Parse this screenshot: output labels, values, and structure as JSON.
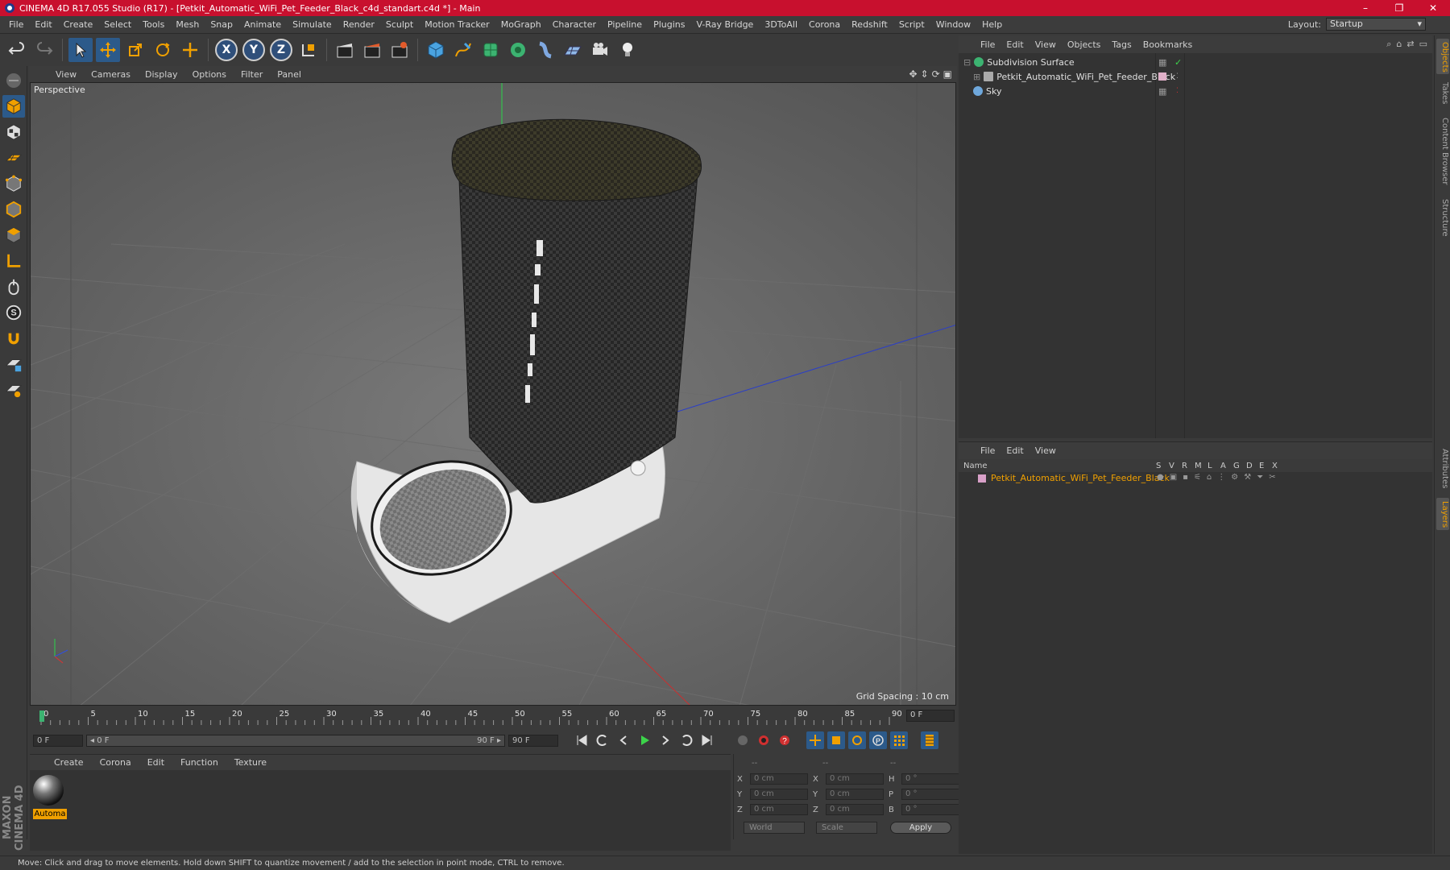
{
  "window": {
    "title": "CINEMA 4D R17.055 Studio (R17) - [Petkit_Automatic_WiFi_Pet_Feeder_Black_c4d_standart.c4d *] - Main",
    "controls": [
      "–",
      "❐",
      "✕"
    ]
  },
  "menubar": {
    "items": [
      "File",
      "Edit",
      "Create",
      "Select",
      "Tools",
      "Mesh",
      "Snap",
      "Animate",
      "Simulate",
      "Render",
      "Sculpt",
      "Motion Tracker",
      "MoGraph",
      "Character",
      "Pipeline",
      "Plugins",
      "V-Ray Bridge",
      "3DToAll",
      "Corona",
      "Redshift",
      "Script",
      "Window",
      "Help"
    ],
    "layout_label": "Layout:",
    "layout_value": "Startup"
  },
  "toolbar": {
    "axis_x": "X",
    "axis_y": "Y",
    "axis_z": "Z"
  },
  "viewport": {
    "menu": [
      "View",
      "Cameras",
      "Display",
      "Options",
      "Filter",
      "Panel"
    ],
    "label": "Perspective",
    "grid_spacing": "Grid Spacing : 10 cm",
    "nav_icons": [
      "✥",
      "⇕",
      "⟳",
      "▣"
    ]
  },
  "timeline": {
    "ticks": [
      "0",
      "5",
      "10",
      "15",
      "20",
      "25",
      "30",
      "35",
      "40",
      "45",
      "50",
      "55",
      "60",
      "65",
      "70",
      "75",
      "80",
      "85",
      "90"
    ],
    "end_field": "0 F"
  },
  "transport": {
    "start": "0 F",
    "range_start": "◂ 0 F",
    "range_end": "90 F ▸",
    "end": "90 F"
  },
  "material_manager": {
    "menu": [
      "Create",
      "Corona",
      "Edit",
      "Function",
      "Texture"
    ],
    "material_name": "Automa"
  },
  "coordinates": {
    "headers": [
      "--",
      "--",
      "--"
    ],
    "rows": [
      {
        "a": "X",
        "av": "0 cm",
        "b": "X",
        "bv": "0 cm",
        "c": "H",
        "cv": "0 °"
      },
      {
        "a": "Y",
        "av": "0 cm",
        "b": "Y",
        "bv": "0 cm",
        "c": "P",
        "cv": "0 °"
      },
      {
        "a": "Z",
        "av": "0 cm",
        "b": "Z",
        "bv": "0 cm",
        "c": "B",
        "cv": "0 °"
      }
    ],
    "mode1": "World",
    "mode2": "Scale",
    "apply": "Apply"
  },
  "statusbar": {
    "text": "Move: Click and drag to move elements. Hold down SHIFT to quantize movement / add to the selection in point mode, CTRL to remove."
  },
  "branding": {
    "logo": "MAXON CINEMA 4D"
  },
  "object_manager": {
    "menu": [
      "File",
      "Edit",
      "View",
      "Objects",
      "Tags",
      "Bookmarks"
    ],
    "objects": [
      {
        "name": "Subdivision Surface",
        "icon_color": "#3cb371"
      },
      {
        "name": "Petkit_Automatic_WiFi_Pet_Feeder_Black",
        "icon_color": "#aaaaaa"
      },
      {
        "name": "Sky",
        "icon_color": "#6fa8dc"
      }
    ]
  },
  "layer_manager": {
    "menu": [
      "File",
      "Edit",
      "View"
    ],
    "columns": [
      "Name",
      "S",
      "V",
      "R",
      "M",
      "L",
      "A",
      "G",
      "D",
      "E",
      "X"
    ],
    "layers": [
      {
        "name": "Petkit_Automatic_WiFi_Pet_Feeder_Black",
        "color": "#d8a0c8"
      }
    ]
  },
  "side_tabs": [
    "Objects",
    "Takes",
    "Content Browser",
    "Structure",
    "Attributes",
    "Layers"
  ],
  "colors": {
    "title_bar": "#c8102e",
    "accent": "#f0a000",
    "viewport_bg": "#606060"
  }
}
